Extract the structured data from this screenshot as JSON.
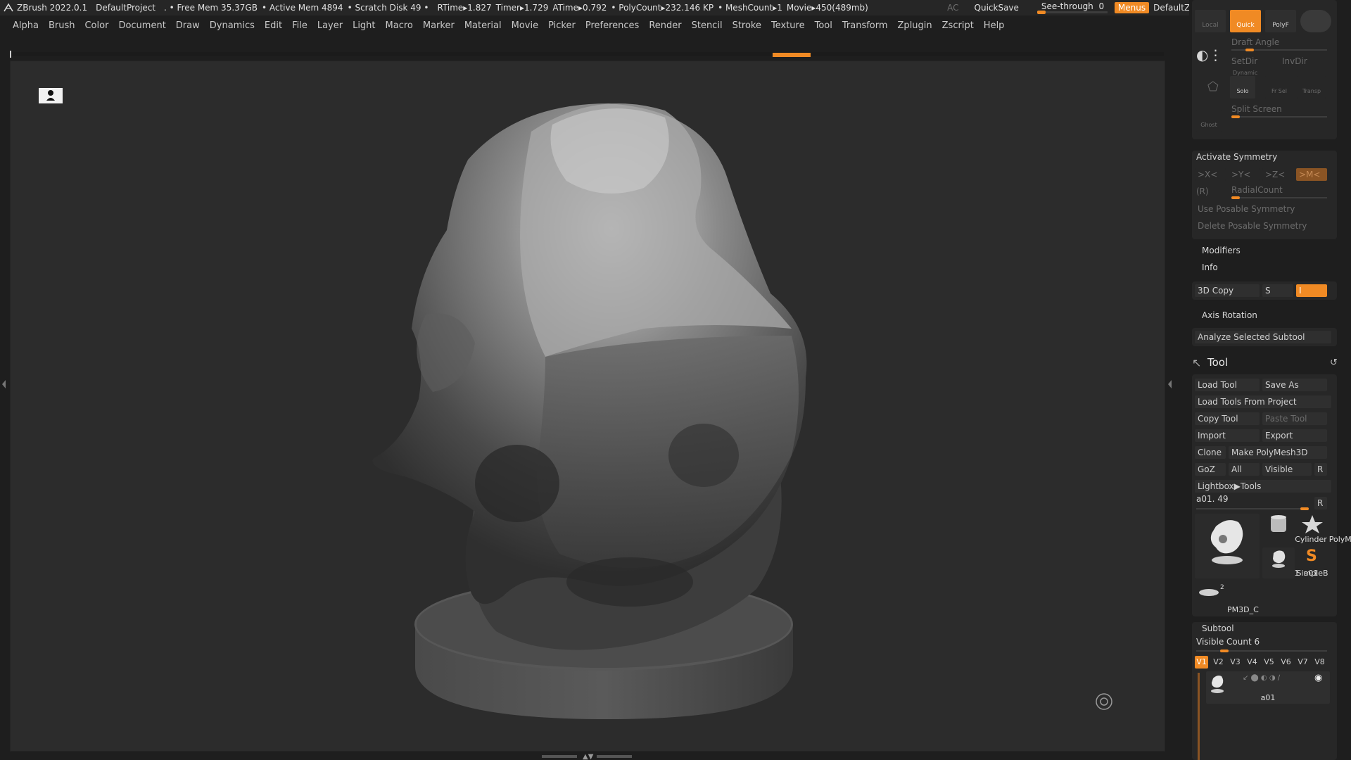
{
  "title_bar": {
    "app": "ZBrush 2022.0.1",
    "project": "DefaultProject",
    "free_mem": ". • Free Mem 35.37GB",
    "active_mem": "• Active Mem 4894",
    "scratch_disk": "• Scratch Disk 49 •",
    "rtime": "RTime▸1.827",
    "timer": "Timer▸1.729",
    "atime": "ATime▸0.792",
    "polycount": "• PolyCount▸232.146 KP",
    "meshcount": "• MeshCount▸1",
    "movie": "Movie▸450(489mb)",
    "ac": "AC",
    "quicksave": "QuickSave",
    "see_through_label": "See-through",
    "see_through_value": "0",
    "see_through_level": 0.0,
    "menus": "Menus",
    "zscript": "DefaultZScript"
  },
  "menu": [
    "Alpha",
    "Brush",
    "Color",
    "Document",
    "Draw",
    "Dynamics",
    "Edit",
    "File",
    "Layer",
    "Light",
    "Macro",
    "Marker",
    "Material",
    "Movie",
    "Picker",
    "Preferences",
    "Render",
    "Stencil",
    "Stroke",
    "Texture",
    "Tool",
    "Transform",
    "Zplugin",
    "Zscript",
    "Help"
  ],
  "top_palette": {
    "local": "Local",
    "quick": "Quick",
    "polyf": "PolyF",
    "draft_angle": "Draft Angle",
    "setdir": "SetDir",
    "invdir": "InvDir",
    "dynamic": "Dynamic",
    "solo": "Solo",
    "frsel": "Fr Sel",
    "transp": "Transp",
    "ghost": "Ghost",
    "split_screen": "Split Screen"
  },
  "symmetry": {
    "activate": "Activate Symmetry",
    "x": ">X<",
    "y": ">Y<",
    "z": ">Z<",
    "m": ">M<",
    "r": "(R)",
    "radial": "RadialCount",
    "use_posable": "Use Posable Symmetry",
    "delete_posable": "Delete Posable Symmetry"
  },
  "transform_extra": {
    "modifiers": "Modifiers",
    "info": "Info",
    "copy3d": "3D Copy",
    "s": "S",
    "i": "I",
    "axis_rotation": "Axis Rotation",
    "analyze": "Analyze Selected Subtool"
  },
  "tool": {
    "title": "Tool",
    "load_tool": "Load Tool",
    "save_as": "Save As",
    "load_from_project": "Load Tools From Project",
    "copy_tool": "Copy Tool",
    "paste_tool": "Paste Tool",
    "import": "Import",
    "export": "Export",
    "clone": "Clone",
    "make_polymesh": "Make PolyMesh3D",
    "goz": "GoZ",
    "all": "All",
    "visible": "Visible",
    "r": "R",
    "lightbox": "Lightbox▶Tools",
    "current_tool": "a01. 49",
    "thumbs": {
      "main": "a01",
      "cylinder": "Cylinder",
      "polymesh": "PolyMes",
      "a01_small": "a01",
      "simpleb": "SimpleB",
      "pm3d": "PM3D_C",
      "pm3d_count": "2"
    }
  },
  "subtool": {
    "title": "Subtool",
    "visible_count": "Visible Count 6",
    "tabs": [
      "V1",
      "V2",
      "V3",
      "V4",
      "V5",
      "V6",
      "V7",
      "V8"
    ],
    "active_tab": "V1",
    "item_name": "a01"
  },
  "colors": {
    "accent": "#f08a24",
    "panel": "#272727",
    "viewport": "#2c2c2c"
  }
}
